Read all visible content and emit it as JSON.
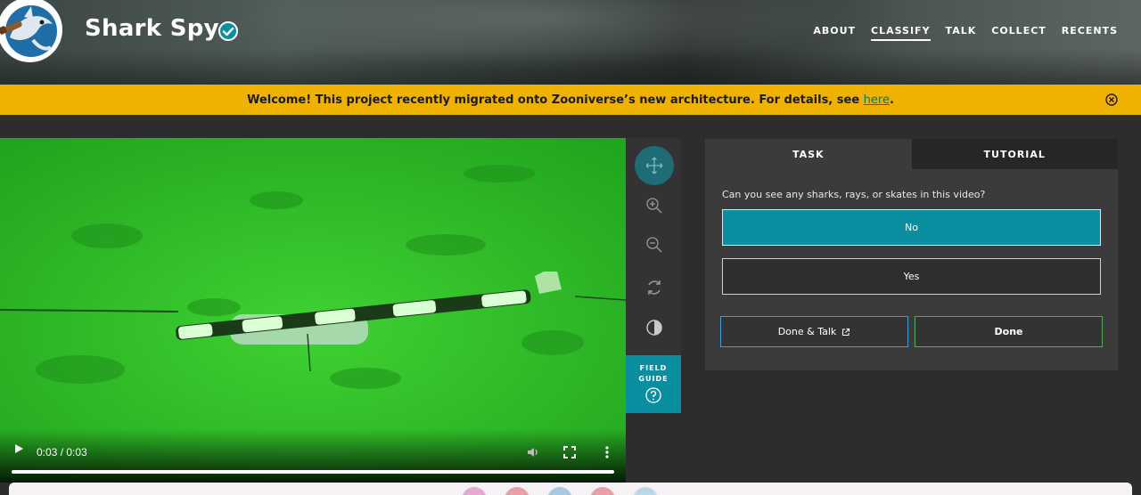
{
  "header": {
    "project_title": "Shark Spy",
    "nav": [
      "ABOUT",
      "CLASSIFY",
      "TALK",
      "COLLECT",
      "RECENTS"
    ],
    "active_nav": "CLASSIFY"
  },
  "banner": {
    "text": "Welcome! This project recently migrated onto Zooniverse’s new architecture. For details, see ",
    "link_text": "here",
    "suffix": ".",
    "color": "#f0b200"
  },
  "video": {
    "time": "0:03 / 0:03",
    "progress": 1.0
  },
  "toolbar": {
    "tools": [
      "move-icon",
      "zoom-in-icon",
      "zoom-out-icon",
      "rotate-icon",
      "invert-icon"
    ],
    "active_tool": "move-icon",
    "field_guide_label": "FIELD GUIDE"
  },
  "task_panel": {
    "tabs": [
      "TASK",
      "TUTORIAL"
    ],
    "active_tab": "TASK",
    "question": "Can you see any sharks, rays, or skates in this video?",
    "answers": [
      "No",
      "Yes"
    ],
    "selected_answer": "No",
    "done_talk_label": "Done & Talk",
    "done_label": "Done"
  },
  "colors": {
    "accent": "#0b8e9f",
    "done_border": "#4fae58",
    "talk_border": "#3f9fd8",
    "panel_bg": "#3b3b3b",
    "page_bg": "#2d2d2d"
  }
}
